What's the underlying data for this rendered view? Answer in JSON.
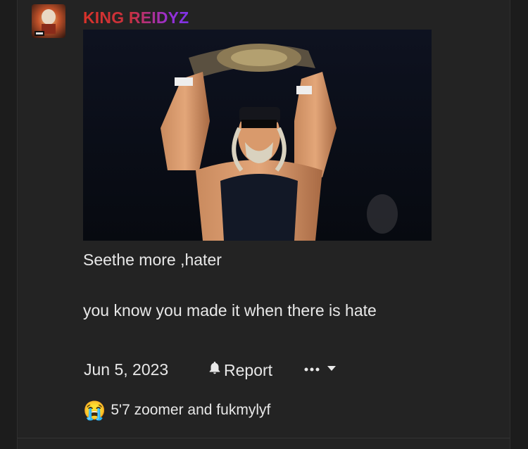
{
  "post": {
    "author": "KING REIDYZ",
    "message_lines": [
      "Seethe more ,hater",
      "you know you made it when there is hate"
    ],
    "date": "Jun 5, 2023",
    "report_label": "Report",
    "reactions": {
      "emoji": "😭",
      "text": "5'7 zoomer and fukmylyf"
    }
  },
  "colors": {
    "background": "#1c1c1c",
    "post_background": "#232323",
    "username_gradient": [
      "#d8322a",
      "#7c33e8"
    ],
    "text": "#e8e8e8"
  }
}
